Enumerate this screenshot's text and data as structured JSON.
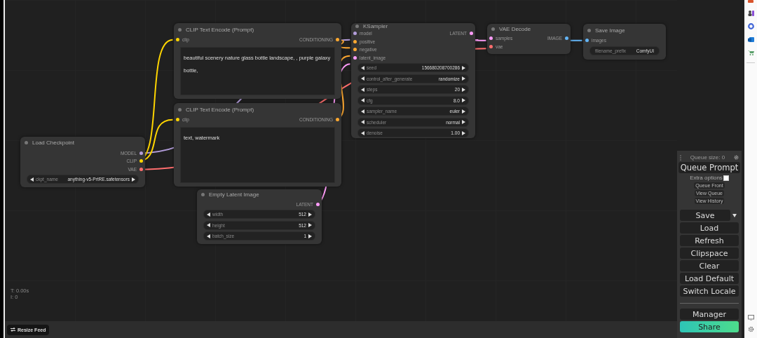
{
  "nodes": [
    {
      "title": "CLIP Text Encode (Prompt)",
      "inputs": [
        {
          "label": "clip",
          "color": "#ffd500"
        }
      ],
      "outputs": [
        {
          "label": "CONDITIONING",
          "color": "#ffa931"
        }
      ],
      "widgets": [
        {
          "kind": "text",
          "value": "beautiful scenery nature glass bottle landscape, , purple galaxy bottle,"
        }
      ]
    },
    {
      "title": "KSampler",
      "inputs": [
        {
          "label": "model",
          "color": "#b39ddb"
        },
        {
          "label": "positive",
          "color": "#ffa931"
        },
        {
          "label": "negative",
          "color": "#ffa931"
        },
        {
          "label": "latent_image",
          "color": "#ff9cf9"
        }
      ],
      "outputs": [
        {
          "label": "LATENT",
          "color": "#ff9cf9"
        }
      ],
      "widgets": [
        {
          "kind": "stepper",
          "name": "seed",
          "value": "156680208700286"
        },
        {
          "kind": "stepper",
          "name": "control_after_generate",
          "value": "randomize"
        },
        {
          "kind": "stepper",
          "name": "steps",
          "value": "20"
        },
        {
          "kind": "stepper",
          "name": "cfg",
          "value": "8.0"
        },
        {
          "kind": "stepper",
          "name": "sampler_name",
          "value": "euler"
        },
        {
          "kind": "stepper",
          "name": "scheduler",
          "value": "normal"
        },
        {
          "kind": "stepper",
          "name": "denoise",
          "value": "1.00"
        }
      ]
    },
    {
      "title": "VAE Decode",
      "inputs": [
        {
          "label": "samples",
          "color": "#ff9cf9"
        },
        {
          "label": "vae",
          "color": "#ff6e6e"
        }
      ],
      "outputs": [
        {
          "label": "IMAGE",
          "color": "#64b5f6"
        }
      ]
    },
    {
      "title": "Save Image",
      "inputs": [
        {
          "label": "images",
          "color": "#64b5f6"
        }
      ],
      "widgets": [
        {
          "kind": "field",
          "name": "filename_prefix",
          "value": "ComfyUI"
        }
      ]
    },
    {
      "title": "CLIP Text Encode (Prompt)",
      "inputs": [
        {
          "label": "clip",
          "color": "#ffd500"
        }
      ],
      "outputs": [
        {
          "label": "CONDITIONING",
          "color": "#ffa931"
        }
      ],
      "widgets": [
        {
          "kind": "text",
          "value": "text, watermark"
        }
      ]
    },
    {
      "title": "Load Checkpoint",
      "outputs": [
        {
          "label": "MODEL",
          "color": "#b39ddb"
        },
        {
          "label": "CLIP",
          "color": "#ffd500"
        },
        {
          "label": "VAE",
          "color": "#ff6e6e"
        }
      ],
      "widgets": [
        {
          "kind": "stepper",
          "name": "ckpt_name",
          "value": "anything-v5-PrtRE.safetensors"
        }
      ]
    },
    {
      "title": "Empty Latent Image",
      "outputs": [
        {
          "label": "LATENT",
          "color": "#ff9cf9"
        }
      ],
      "widgets": [
        {
          "kind": "stepper",
          "name": "width",
          "value": "512"
        },
        {
          "kind": "stepper",
          "name": "height",
          "value": "512"
        },
        {
          "kind": "stepper",
          "name": "batch_size",
          "value": "1"
        }
      ]
    }
  ],
  "stats": [
    "T: 0.00s",
    "I: 0"
  ],
  "resize_feed": "Resize Feed",
  "queue_panel": {
    "queue_size": "Queue size: 0",
    "queue_prompt": "Queue Prompt",
    "extra_options": {
      "label": "Extra options",
      "checked": false
    },
    "small_buttons": [
      "Queue Front",
      "View Queue",
      "View History"
    ],
    "buttons": [
      {
        "kind": "split",
        "label": "Save"
      },
      {
        "kind": "plain",
        "label": "Load"
      },
      {
        "kind": "plain",
        "label": "Refresh"
      },
      {
        "kind": "plain",
        "label": "Clipspace"
      },
      {
        "kind": "plain",
        "label": "Clear"
      },
      {
        "kind": "plain",
        "label": "Load Default"
      },
      {
        "kind": "plain",
        "label": "Switch Locale"
      }
    ],
    "manager": "Manager",
    "share": "Share"
  }
}
